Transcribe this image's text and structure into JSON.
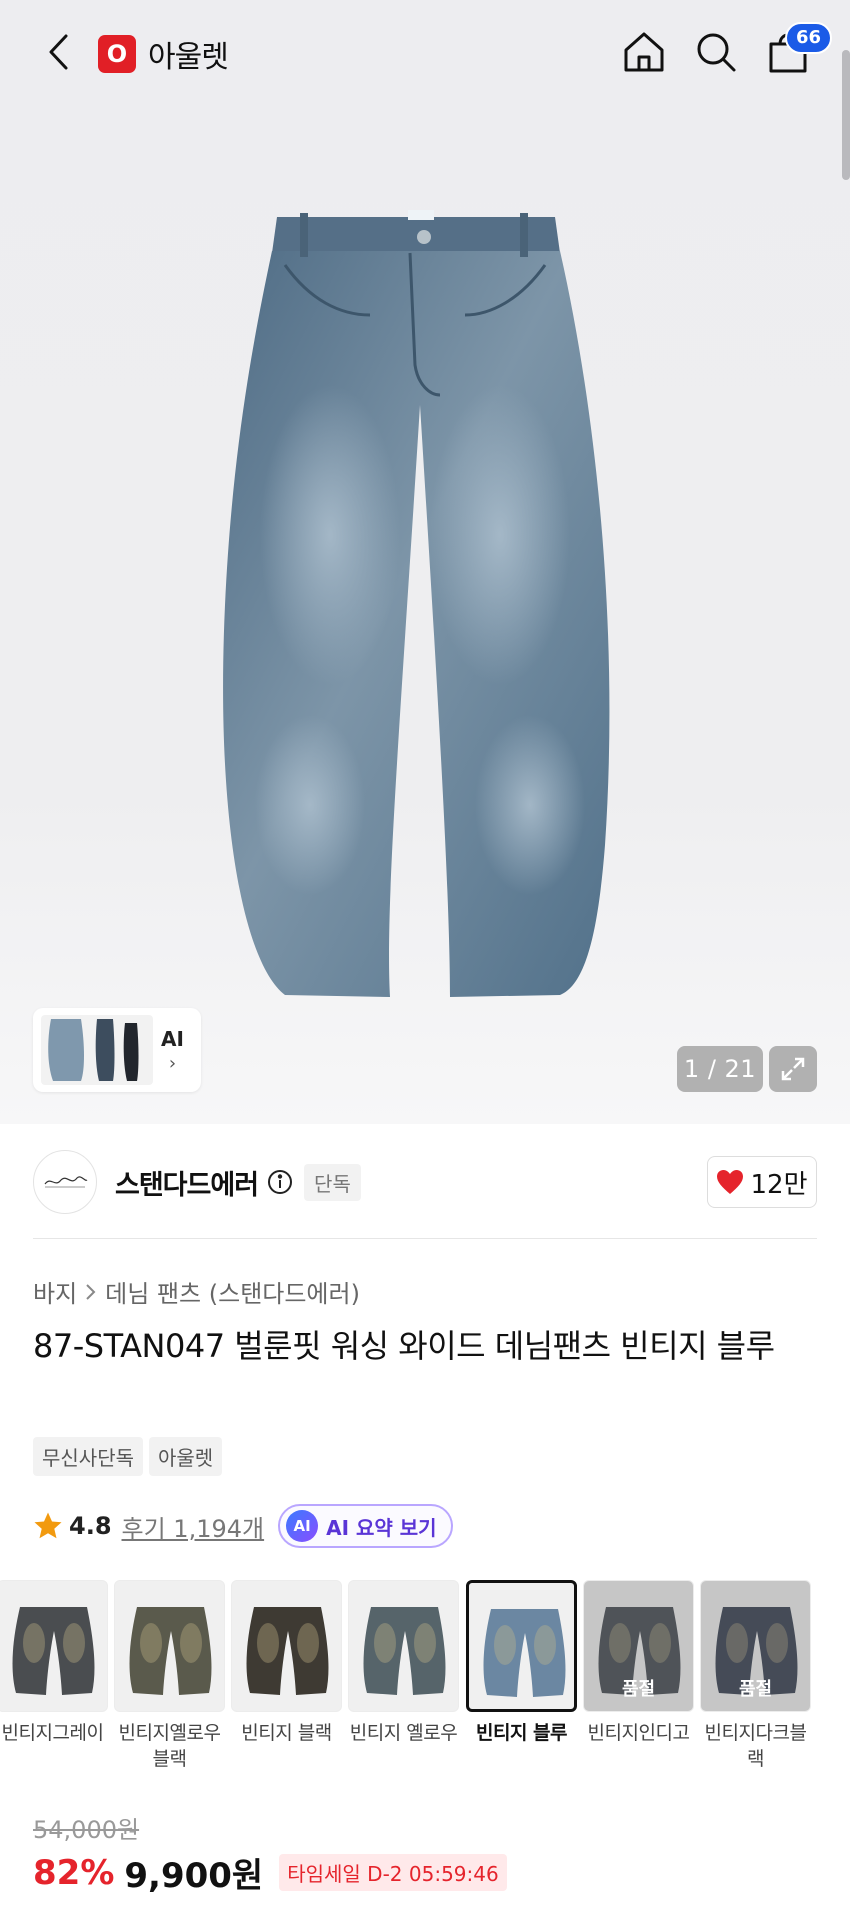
{
  "header": {
    "brand_logo_letter": "O",
    "brand_name": "아울렛",
    "cart_count": "66",
    "icons": [
      "back-icon",
      "home-icon",
      "search-icon",
      "shopping-bag-icon"
    ]
  },
  "gallery": {
    "counter": "1 / 21",
    "thumb_label": "AI",
    "thumb_chevron": "›"
  },
  "store": {
    "name": "스탠다드에러",
    "tag": "단독",
    "likes": "12만",
    "heart_color": "#e5242c"
  },
  "breadcrumb": {
    "category": "바지",
    "subcategory": "데님 팬츠 (스탠다드에러)"
  },
  "product": {
    "title": "87-STAN047 벌룬핏 워싱 와이드 데님팬츠 빈티지 블루",
    "tags": [
      "무신사단독",
      "아울렛"
    ],
    "rating": "4.8",
    "review_label": "후기 1,194개",
    "ai_badge": "AI",
    "ai_summary_label": "AI 요약 보기"
  },
  "options": [
    {
      "label": "빈티지그레이",
      "soldout": false,
      "color": "#4a4d50"
    },
    {
      "label": "빈티지옐로우블랙",
      "soldout": false,
      "color": "#5a5a4c"
    },
    {
      "label": "빈티지 블랙",
      "soldout": false,
      "color": "#3e3a33"
    },
    {
      "label": "빈티지 옐로우",
      "soldout": false,
      "color": "#56646a"
    },
    {
      "label": "빈티지 블루",
      "soldout": false,
      "selected": true,
      "color": "#6b87a2"
    },
    {
      "label": "빈티지인디고",
      "soldout": true,
      "color": "#3a4048"
    },
    {
      "label": "빈티지다크블랙",
      "soldout": true,
      "color": "#2a3446"
    }
  ],
  "soldout_label": "품절",
  "price": {
    "original": "54,000원",
    "discount": "82%",
    "sale": "9,900원",
    "timesale": "타임세일 D-2 05:59:46"
  },
  "colors": {
    "brand_red": "#e11f26",
    "badge_blue": "#1b5be7",
    "discount_red": "#e5242c",
    "star": "#f29a0f"
  }
}
